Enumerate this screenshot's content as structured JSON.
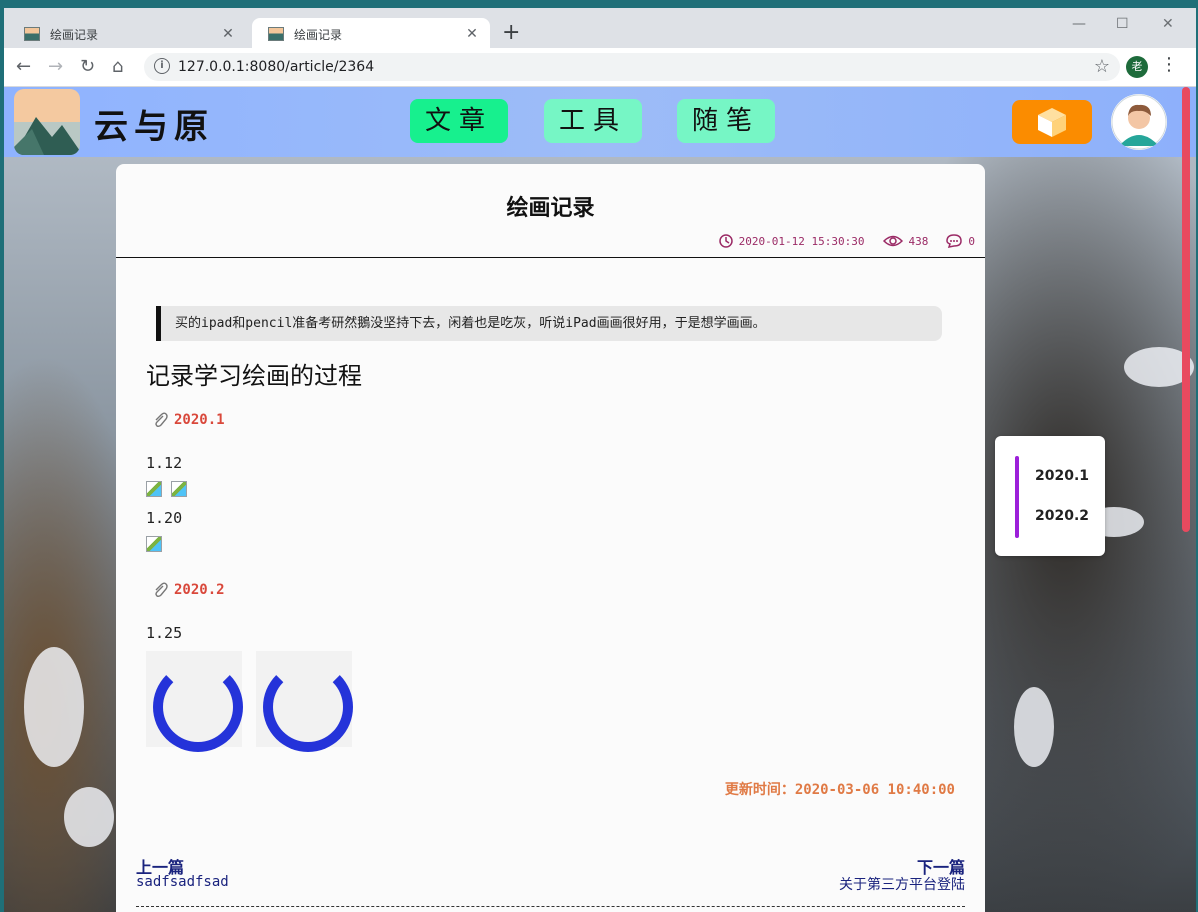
{
  "browser": {
    "tabs": [
      {
        "title": "绘画记录",
        "active": false
      },
      {
        "title": "绘画记录",
        "active": true
      }
    ],
    "new_tab_icon": "+",
    "url": "127.0.0.1:8080/article/2364",
    "profile_initial": "老",
    "window_controls": {
      "minimize": "—",
      "maximize": "☐",
      "close": "✕"
    }
  },
  "site": {
    "name": "云与原",
    "nav": [
      {
        "label": "文章",
        "color": "#17f08e"
      },
      {
        "label": "工具",
        "color": "#76f6c5"
      },
      {
        "label": "随笔",
        "color": "#76f6c5"
      }
    ],
    "accent_orange": "#fb8c00"
  },
  "article": {
    "title": "绘画记录",
    "published": "2020-01-12 15:30:30",
    "views": "438",
    "comments": "0",
    "quote": "买的ipad和pencil准备考研然鵝没坚持下去，闲着也是吃灰，听说iPad画画很好用，于是想学画画。",
    "heading": "记录学习绘画的过程",
    "sections": [
      {
        "title": "2020.1",
        "entries": [
          "1.12",
          "1.20"
        ]
      },
      {
        "title": "2020.2",
        "entries": [
          "1.25"
        ]
      }
    ],
    "updated": "更新时间：2020-03-06 10:40:00",
    "prev": {
      "label": "上一篇",
      "title": "sadfsadfsad"
    },
    "next": {
      "label": "下一篇",
      "title": "关于第三方平台登陆"
    }
  },
  "toc": [
    "2020.1",
    "2020.2"
  ],
  "colors": {
    "meta": "#9b2b66",
    "section_title": "#d9483b",
    "spinner": "#2433d9",
    "toc_bar": "#9c1fd9",
    "updated": "#e07a45",
    "link": "#1a237e"
  }
}
